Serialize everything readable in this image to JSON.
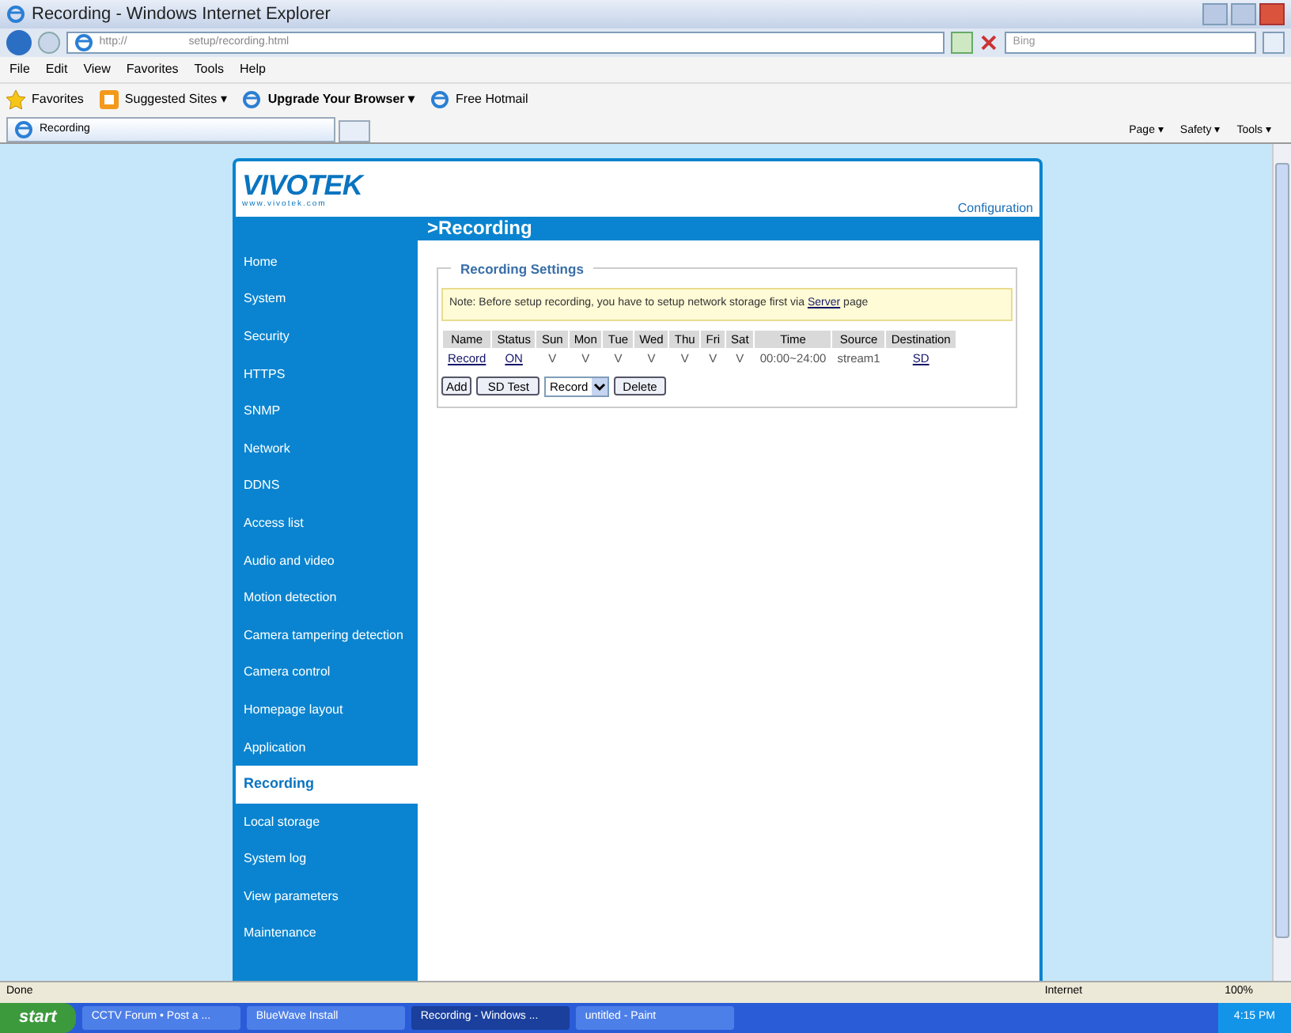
{
  "window": {
    "title": "Recording - Windows Internet Explorer"
  },
  "address": {
    "url": "http://                    setup/recording.html"
  },
  "search": {
    "placeholder": "Bing"
  },
  "menu": [
    "File",
    "Edit",
    "View",
    "Favorites",
    "Tools",
    "Help"
  ],
  "favorites_bar": [
    {
      "label": "Favorites",
      "kind": "star"
    },
    {
      "label": "Suggested Sites ▾",
      "kind": "sites"
    },
    {
      "label": "Upgrade Your Browser ▾",
      "kind": "upgrade"
    },
    {
      "label": "Free Hotmail",
      "kind": "page"
    }
  ],
  "tab": {
    "label": "Recording"
  },
  "command_bar": [
    "Page ▾",
    "Safety ▾",
    "Tools ▾"
  ],
  "page": {
    "logo": "VIVOTEK",
    "logo_url": "www.vivotek.com",
    "config_link": "Configuration",
    "heading": ">Recording",
    "sidebar": [
      {
        "label": "Home",
        "selected": false
      },
      {
        "label": "System",
        "selected": false
      },
      {
        "label": "Security",
        "selected": false
      },
      {
        "label": "HTTPS",
        "selected": false
      },
      {
        "label": "SNMP",
        "selected": false
      },
      {
        "label": "Network",
        "selected": false
      },
      {
        "label": "DDNS",
        "selected": false
      },
      {
        "label": "Access list",
        "selected": false
      },
      {
        "label": "Audio and video",
        "selected": false
      },
      {
        "label": "Motion detection",
        "selected": false
      },
      {
        "label": "Camera tampering detection",
        "selected": false
      },
      {
        "label": "Camera control",
        "selected": false
      },
      {
        "label": "Homepage layout",
        "selected": false
      },
      {
        "label": "Application",
        "selected": false
      },
      {
        "label": "Recording",
        "selected": true
      },
      {
        "label": "Local storage",
        "selected": false
      },
      {
        "label": "System log",
        "selected": false
      },
      {
        "label": "View parameters",
        "selected": false
      },
      {
        "label": "Maintenance",
        "selected": false
      }
    ],
    "settings": {
      "title": "Recording Settings",
      "note": "Note: Before setup recording, you have to setup network storage first via",
      "note_link": "Server",
      "note_end": "page",
      "columns": [
        "Name",
        "Status",
        "Sun",
        "Mon",
        "Tue",
        "Wed",
        "Thu",
        "Fri",
        "Sat",
        "Time",
        "Source",
        "Destination"
      ],
      "rows": [
        [
          {
            "text": "Record",
            "kind": "link"
          },
          {
            "text": "ON",
            "kind": "link"
          },
          {
            "text": "V",
            "kind": "text"
          },
          {
            "text": "V",
            "kind": "text"
          },
          {
            "text": "V",
            "kind": "text"
          },
          {
            "text": "V",
            "kind": "text"
          },
          {
            "text": "V",
            "kind": "text"
          },
          {
            "text": "V",
            "kind": "text"
          },
          {
            "text": "V",
            "kind": "text"
          },
          {
            "text": "00:00~24:00",
            "kind": "text"
          },
          {
            "text": "stream1",
            "kind": "text"
          },
          {
            "text": "SD",
            "kind": "link"
          }
        ]
      ],
      "add_button": "Add",
      "test_button": "SD Test",
      "select_value": "Record",
      "delete_button": "Delete"
    }
  },
  "status_bar": {
    "text": "Done",
    "zone": "Internet",
    "zoom": "100%"
  },
  "taskbar": {
    "start": "start",
    "tasks": [
      {
        "label": "CCTV Forum • Post a ...",
        "selected": false
      },
      {
        "label": "BlueWave Install",
        "selected": false
      },
      {
        "label": "Recording - Windows ...",
        "selected": true
      },
      {
        "label": "untitled - Paint",
        "selected": false
      }
    ],
    "clock": "4:15 PM"
  }
}
